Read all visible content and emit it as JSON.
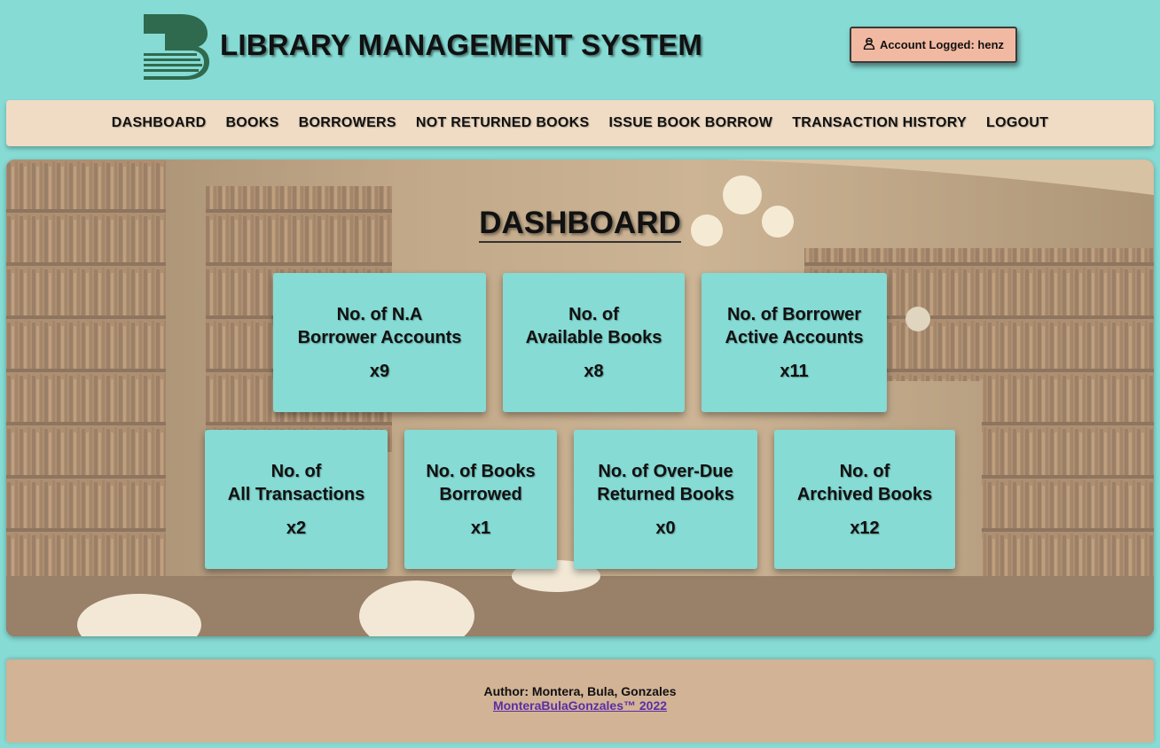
{
  "header": {
    "title": "LIBRARY MANAGEMENT SYSTEM",
    "account_label": "Account Logged: henz"
  },
  "nav": {
    "items": [
      {
        "label": "DASHBOARD"
      },
      {
        "label": "BOOKS"
      },
      {
        "label": "BORROWERS"
      },
      {
        "label": "NOT RETURNED BOOKS"
      },
      {
        "label": "ISSUE BOOK BORROW"
      },
      {
        "label": "TRANSACTION HISTORY"
      },
      {
        "label": "LOGOUT"
      }
    ]
  },
  "dashboard": {
    "title": "DASHBOARD",
    "cards": [
      {
        "label": "No. of N.A\nBorrower Accounts",
        "value": "x9"
      },
      {
        "label": "No. of\nAvailable Books",
        "value": "x8"
      },
      {
        "label": "No. of Borrower\nActive Accounts",
        "value": "x11"
      },
      {
        "label": "No. of\nAll Transactions",
        "value": "x2"
      },
      {
        "label": "No. of Books\nBorrowed",
        "value": "x1"
      },
      {
        "label": "No. of Over-Due\nReturned Books",
        "value": "x0"
      },
      {
        "label": "No. of\nArchived Books",
        "value": "x12"
      }
    ]
  },
  "footer": {
    "author": "Author: Montera, Bula, Gonzales",
    "link": "MonteraBulaGonzales™ 2022"
  },
  "colors": {
    "page_bg": "#86dbd4",
    "nav_bg": "#f0dcc4",
    "account_bg": "#f2b9a2",
    "footer_bg": "#d2b396",
    "logo_green": "#2f6a4e",
    "link": "#5b2ea6"
  }
}
